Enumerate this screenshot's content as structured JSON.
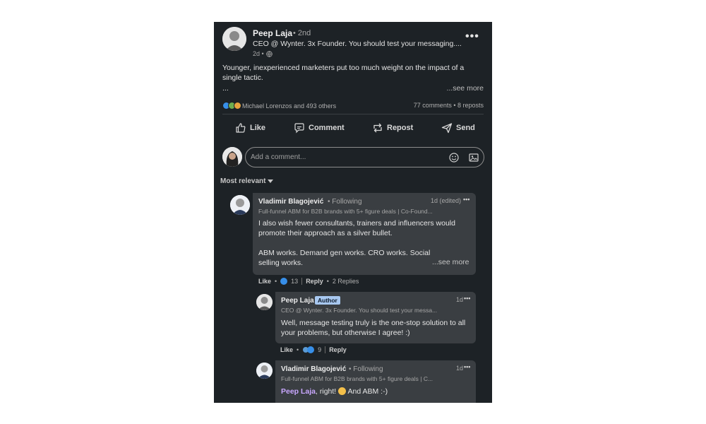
{
  "post": {
    "author_name": "Peep Laja",
    "author_degree": "• 2nd",
    "author_headline": "CEO @ Wynter. 3x Founder. You should test your messaging....",
    "time": "2d •",
    "text": "Younger, inexperienced marketers put too much weight on the impact of a single tactic.",
    "ellipsis": "...",
    "see_more": "...see more",
    "reactions_text": "Michael Lorenzos and 493 others",
    "stats_text": "77 comments • 8 reposts"
  },
  "actions": {
    "like": "Like",
    "comment": "Comment",
    "repost": "Repost",
    "send": "Send"
  },
  "comment_input": {
    "placeholder": "Add a comment..."
  },
  "sort_label": "Most relevant",
  "comments": [
    {
      "name": "Vladimir Blagojević",
      "following": "• Following",
      "headline": "Full-funnel ABM for B2B brands with 5+ figure deals | Co-Found...",
      "time": "1d (edited)",
      "text1": "I also wish fewer consultants, trainers and influencers would promote their approach as a silver bullet.",
      "text2": "ABM works. Demand gen works. CRO works. Social selling works.",
      "see_more": "...see more",
      "like": "Like",
      "reaction_count": "13",
      "reply": "Reply",
      "replies": "2 Replies"
    },
    {
      "name": "Peep Laja",
      "badge": "Author",
      "headline": "CEO @ Wynter. 3x Founder. You should test your messa...",
      "time": "1d",
      "text": "Well, message testing truly is the one-stop solution to all your problems, but otherwise I agree! :)",
      "like": "Like",
      "reaction_count": "9",
      "reply": "Reply"
    },
    {
      "name": "Vladimir Blagojević",
      "following": "• Following",
      "headline": "Full-funnel ABM for B2B brands with 5+ figure deals | C...",
      "time": "1d",
      "mention": "Peep Laja",
      "text_after": ", right!",
      "text_end": "And ABM :-)"
    }
  ],
  "colors": {
    "background": "#1d2226",
    "bubble": "#3a3e42",
    "mention": "#c9a7ff",
    "like_blue": "#378fe9"
  }
}
